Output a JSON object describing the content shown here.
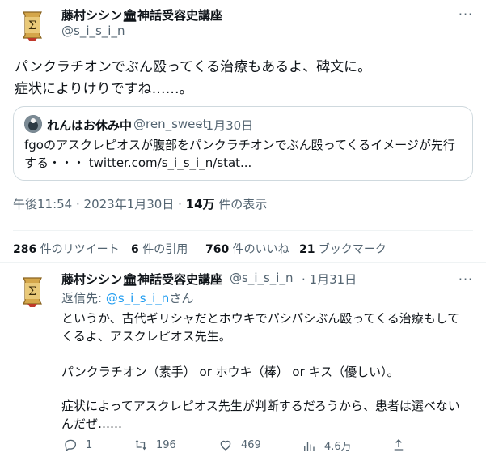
{
  "colors": {
    "accent": "#1d9bf0",
    "text": "#0f1419",
    "muted": "#536471",
    "border": "#cfd9de"
  },
  "tweet": {
    "author_name": "藤村シシン🏛神話受容史講座",
    "author_handle": "@s_i_s_i_n",
    "text_line1": "パンクラチオンでぶん殴ってくる治療もあるよ、碑文に。",
    "text_line2": "症状によりけりですね……。",
    "quote": {
      "author_name": "れんはお休み中",
      "author_handle": "@ren_sweet",
      "date": "· 1月30日",
      "text_line1": "fgoのアスクレピオスが腹部をパンクラチオンでぶん殴ってくるイメージが先行",
      "text_line2": "する・・・ twitter.com/s_i_s_i_n/stat..."
    },
    "timestamp": "午後11:54 · 2023年1月30日 · ",
    "views_count": "14万",
    "views_label": " 件の表示",
    "stats": {
      "retweets_count": "286",
      "retweets_label": " 件のリツイート",
      "quotes_count": "6",
      "quotes_label": " 件の引用",
      "likes_count": "760",
      "likes_label": " 件のいいね",
      "bookmarks_count": "21",
      "bookmarks_label": " ブックマーク"
    }
  },
  "reply": {
    "author_name": "藤村シシン🏛神話受容史講座",
    "author_handle": "@s_i_s_i_n",
    "date": "· 1月31日",
    "replying_prefix": "返信先: ",
    "replying_handle": "@s_i_s_i_n",
    "replying_suffix": "さん",
    "text_line1": "というか、古代ギリシャだとホウキでパシパシぶん殴ってくる治療もして",
    "text_line2": "くるよ、アスクレピオス先生。",
    "text_line3": "パンクラチオン（素手） or ホウキ（棒） or キス（優しい）。",
    "text_line4": "症状によってアスクレピオス先生が判断するだろうから、患者は選べない",
    "text_line5": "んだぜ……",
    "actions": {
      "reply_count": "1",
      "retweet_count": "196",
      "like_count": "469",
      "views_count": "4.6万"
    }
  }
}
